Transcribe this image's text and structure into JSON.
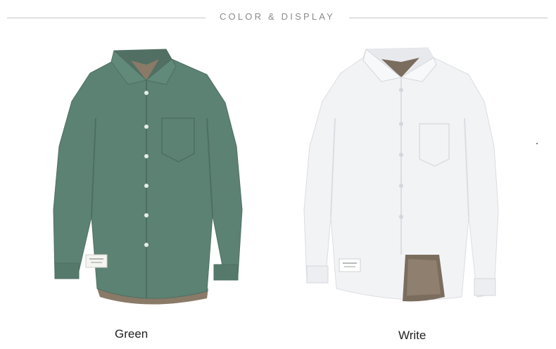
{
  "header": {
    "title": "COLOR & DISPLAY"
  },
  "products": [
    {
      "color_name": "Green",
      "shirt_color": "#5c8273",
      "shirt_shade": "#4d6f62",
      "lining_color": "#8a7a68"
    },
    {
      "color_name": "Write",
      "shirt_color": "#f2f3f5",
      "shirt_shade": "#dcdde2",
      "lining_color": "#7b6d5e"
    }
  ],
  "colors": {
    "rule": "#c8c8c8",
    "title_text": "#8a8a8a",
    "caption_text": "#222222",
    "background": "#ffffff"
  }
}
